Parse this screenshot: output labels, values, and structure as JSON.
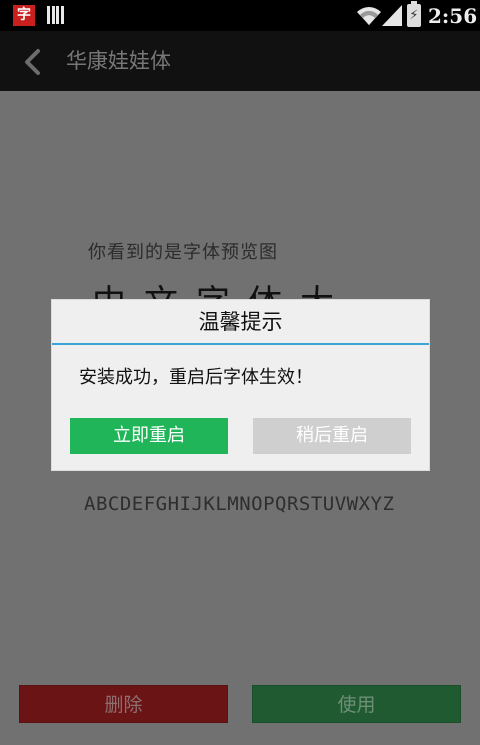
{
  "status_bar": {
    "app_icon_char": "字",
    "time": "2:56"
  },
  "action_bar": {
    "title": "华康娃娃体"
  },
  "preview": {
    "caption": "你看到的是字体预览图",
    "large_text": "中文字体大小",
    "alphabet": "ABCDEFGHIJKLMNOPQRSTUVWXYZ"
  },
  "bottom_buttons": {
    "delete_label": "删除",
    "use_label": "使用"
  },
  "dialog": {
    "title": "温馨提示",
    "message": "安装成功，重启后字体生效！",
    "restart_now_label": "立即重启",
    "restart_later_label": "稍后重启"
  },
  "colors": {
    "accent_blue": "#3aa6d8",
    "primary_green": "#21b55a",
    "delete_red": "#6b1415",
    "overlay_gray": "#717171"
  }
}
